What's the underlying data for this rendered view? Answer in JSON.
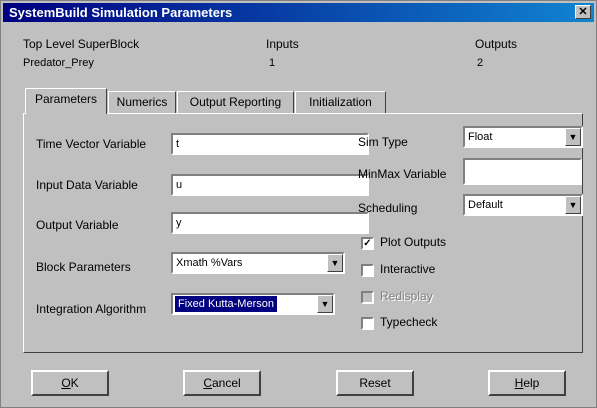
{
  "window": {
    "title": "SystemBuild Simulation Parameters",
    "close_glyph": "✕"
  },
  "info": {
    "headers": {
      "block": "Top Level SuperBlock",
      "inputs": "Inputs",
      "outputs": "Outputs"
    },
    "values": {
      "block": "Predator_Prey",
      "inputs": "1",
      "outputs": "2"
    }
  },
  "tabs": [
    {
      "label": "Parameters",
      "active": true
    },
    {
      "label": "Numerics",
      "active": false
    },
    {
      "label": "Output Reporting",
      "active": false
    },
    {
      "label": "Initialization",
      "active": false
    }
  ],
  "form": {
    "time_vector": {
      "label": "Time Vector Variable",
      "value": "t"
    },
    "input_data": {
      "label": "Input Data Variable",
      "value": "u"
    },
    "output_var": {
      "label": "Output Variable",
      "value": "y"
    },
    "block_params": {
      "label": "Block Parameters",
      "value": "Xmath %Vars"
    },
    "integration": {
      "label": "Integration Algorithm",
      "value": "Fixed Kutta-Merson"
    },
    "sim_type": {
      "label": "Sim Type",
      "value": "Float"
    },
    "minmax": {
      "label": "MinMax Variable",
      "value": ""
    },
    "scheduling": {
      "label": "Scheduling",
      "value": "Default"
    }
  },
  "checks": [
    {
      "label": "Plot Outputs",
      "checked": true,
      "enabled": true
    },
    {
      "label": "Interactive",
      "checked": false,
      "enabled": true
    },
    {
      "label": "Redisplay",
      "checked": false,
      "enabled": false
    },
    {
      "label": "Typecheck",
      "checked": false,
      "enabled": true
    }
  ],
  "buttons": {
    "ok": {
      "key": "O",
      "rest": "K"
    },
    "cancel": {
      "key": "C",
      "rest": "ancel"
    },
    "reset": {
      "label": "Reset"
    },
    "help": {
      "key": "H",
      "rest": "elp"
    }
  },
  "colors": {
    "titlebar_start": "#000080",
    "titlebar_end": "#1084d0",
    "face": "#c0c0c0"
  },
  "icons": {
    "dropdown": "▼",
    "check": "✓"
  }
}
